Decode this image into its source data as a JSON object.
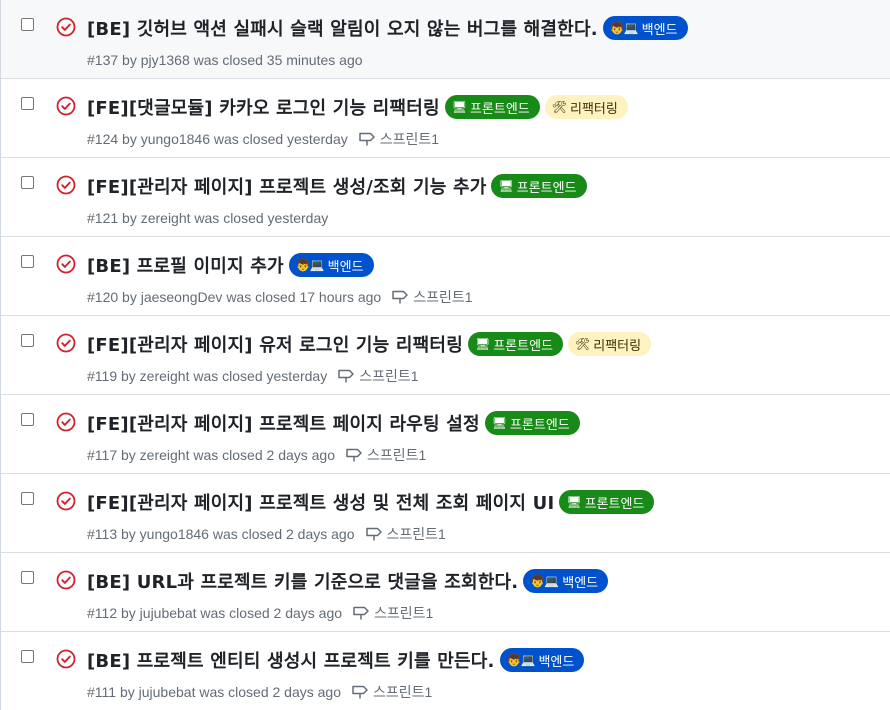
{
  "issues": [
    {
      "title": "[BE] 깃허브 액션 실패시 슬랙 알림이 오지 않는 버그를 해결한다.",
      "meta": "#137 by pjy1368 was closed 35 minutes ago",
      "labels": [
        {
          "kind": "be",
          "emoji": "👦💻",
          "text": "백엔드"
        }
      ],
      "milestone": ""
    },
    {
      "title": "[FE][댓글모듈] 카카오 로그인 기능 리팩터링",
      "meta": "#124 by yungo1846 was closed yesterday",
      "labels": [
        {
          "kind": "fe",
          "emoji": "🖥",
          "text": "프론트엔드"
        },
        {
          "kind": "rf",
          "emoji": "🛠",
          "text": "리팩터링"
        }
      ],
      "milestone": "스프린트1"
    },
    {
      "title": "[FE][관리자 페이지] 프로젝트 생성/조회 기능 추가",
      "meta": "#121 by zereight was closed yesterday",
      "labels": [
        {
          "kind": "fe",
          "emoji": "🖥",
          "text": "프론트엔드"
        }
      ],
      "milestone": ""
    },
    {
      "title": "[BE] 프로필 이미지 추가",
      "meta": "#120 by jaeseongDev was closed 17 hours ago",
      "labels": [
        {
          "kind": "be",
          "emoji": "👦💻",
          "text": "백엔드"
        }
      ],
      "milestone": "스프린트1"
    },
    {
      "title": "[FE][관리자 페이지] 유저 로그인 기능 리팩터링",
      "meta": "#119 by zereight was closed yesterday",
      "labels": [
        {
          "kind": "fe",
          "emoji": "🖥",
          "text": "프론트엔드"
        },
        {
          "kind": "rf",
          "emoji": "🛠",
          "text": "리팩터링"
        }
      ],
      "milestone": "스프린트1"
    },
    {
      "title": "[FE][관리자 페이지] 프로젝트 페이지 라우팅 설정",
      "meta": "#117 by zereight was closed 2 days ago",
      "labels": [
        {
          "kind": "fe",
          "emoji": "🖥",
          "text": "프론트엔드"
        }
      ],
      "milestone": "스프린트1"
    },
    {
      "title": "[FE][관리자 페이지] 프로젝트 생성 및 전체 조회 페이지 UI",
      "meta": "#113 by yungo1846 was closed 2 days ago",
      "labels": [
        {
          "kind": "fe",
          "emoji": "🖥",
          "text": "프론트엔드"
        }
      ],
      "milestone": "스프린트1"
    },
    {
      "title": "[BE] URL과 프로젝트 키를 기준으로 댓글을 조회한다.",
      "meta": "#112 by jujubebat was closed 2 days ago",
      "labels": [
        {
          "kind": "be",
          "emoji": "👦💻",
          "text": "백엔드"
        }
      ],
      "milestone": "스프린트1"
    },
    {
      "title": "[BE] 프로젝트 엔티티 생성시 프로젝트 키를 만든다.",
      "meta": "#111 by jujubebat was closed 2 days ago",
      "labels": [
        {
          "kind": "be",
          "emoji": "👦💻",
          "text": "백엔드"
        }
      ],
      "milestone": "스프린트1"
    }
  ],
  "colors": {
    "closed_icon": "#cf222e",
    "label_be": "#0052cc",
    "label_fe": "#188a18",
    "label_refactor": "#fef2c0",
    "meta_text": "#636c76"
  },
  "icons": {
    "state": "issue-closed-icon",
    "milestone": "milestone-icon"
  }
}
